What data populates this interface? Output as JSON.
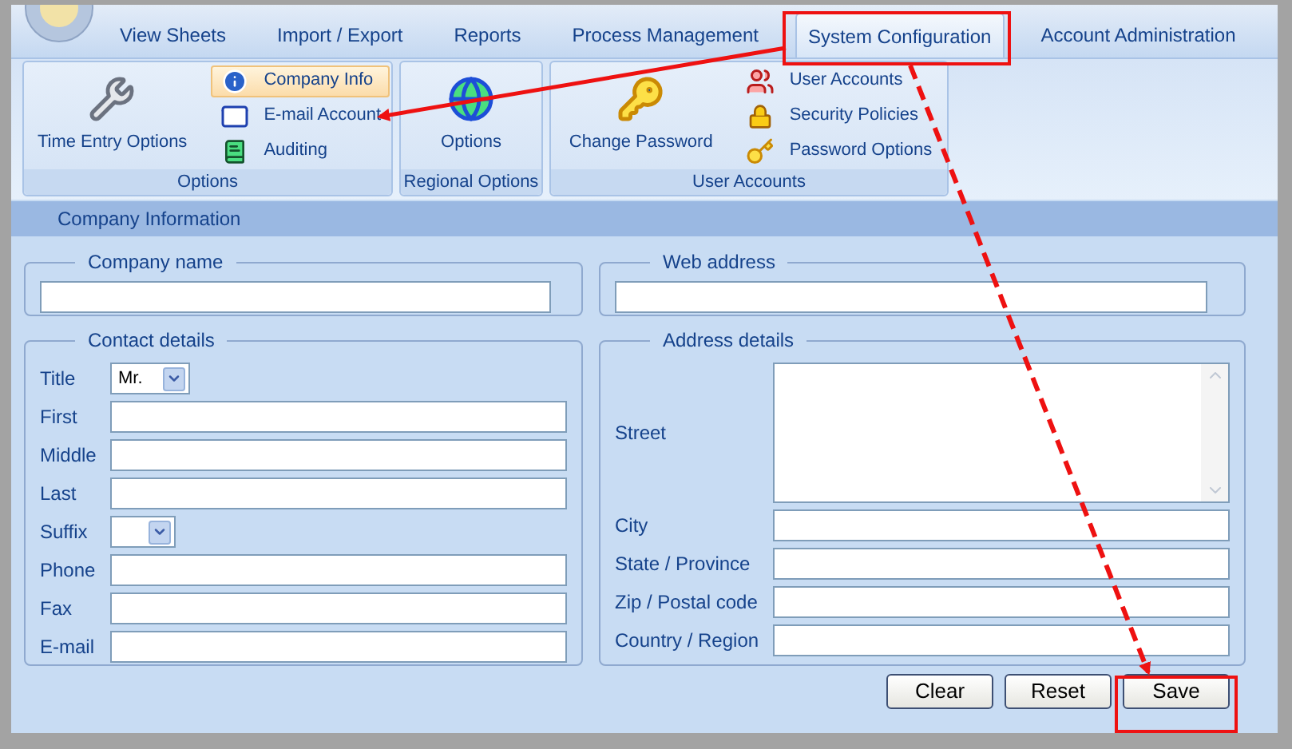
{
  "tabs": [
    {
      "label": "View Sheets",
      "selected": false
    },
    {
      "label": "Import / Export",
      "selected": false
    },
    {
      "label": "Reports",
      "selected": false
    },
    {
      "label": "Process Management",
      "selected": false
    },
    {
      "label": "System Configuration",
      "selected": true
    },
    {
      "label": "Account Administration",
      "selected": false
    }
  ],
  "ribbon_groups": [
    {
      "title": "Options",
      "items": [
        {
          "label": "Time Entry Options",
          "kind": "large",
          "selected": false
        },
        {
          "label": "Company Info",
          "kind": "small",
          "selected": true
        },
        {
          "label": "E-mail Account",
          "kind": "small",
          "selected": false
        },
        {
          "label": "Auditing",
          "kind": "small",
          "selected": false
        }
      ]
    },
    {
      "title": "Regional Options",
      "items": [
        {
          "label": "Options",
          "kind": "large",
          "selected": false
        }
      ]
    },
    {
      "title": "User Accounts",
      "items": [
        {
          "label": "Change Password",
          "kind": "large",
          "selected": false
        },
        {
          "label": "User Accounts",
          "kind": "small",
          "selected": false
        },
        {
          "label": "Security Policies",
          "kind": "small",
          "selected": false
        },
        {
          "label": "Password Options",
          "kind": "small",
          "selected": false
        }
      ]
    }
  ],
  "section_title": "Company Information",
  "company_name": {
    "legend": "Company name"
  },
  "web_address": {
    "legend": "Web address"
  },
  "contact_details": {
    "legend": "Contact details",
    "rows": [
      {
        "label": "Title",
        "kind": "select",
        "value": "Mr."
      },
      {
        "label": "First",
        "kind": "text"
      },
      {
        "label": "Middle",
        "kind": "text"
      },
      {
        "label": "Last",
        "kind": "text"
      },
      {
        "label": "Suffix",
        "kind": "select"
      },
      {
        "label": "Phone",
        "kind": "text"
      },
      {
        "label": "Fax",
        "kind": "text"
      },
      {
        "label": "E-mail",
        "kind": "text"
      }
    ]
  },
  "address_details": {
    "legend": "Address details",
    "rows": [
      {
        "label": "Street",
        "kind": "textarea"
      },
      {
        "label": "City",
        "kind": "text"
      },
      {
        "label": "State / Province",
        "kind": "text"
      },
      {
        "label": "Zip / Postal code",
        "kind": "text"
      },
      {
        "label": "Country / Region",
        "kind": "text"
      }
    ]
  },
  "buttons": [
    "Clear",
    "Reset",
    "Save"
  ]
}
